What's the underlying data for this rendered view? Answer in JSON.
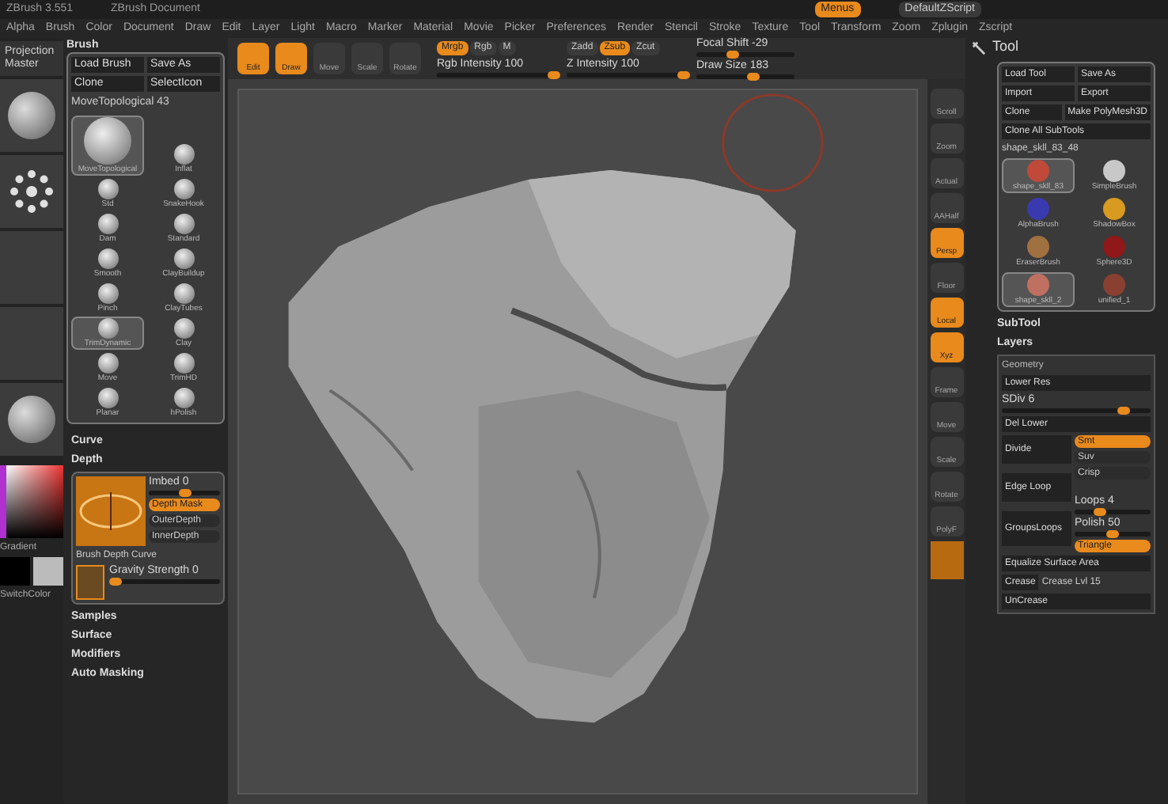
{
  "title_bar": {
    "texts": [
      "ZBrush 3.551",
      "ZBrush Document"
    ],
    "buttons": [
      {
        "label": "Menus",
        "selected": true
      },
      {
        "label": "DefaultZScript",
        "selected": false
      }
    ]
  },
  "menu_bar": [
    "Alpha",
    "Brush",
    "Color",
    "Document",
    "Draw",
    "Edit",
    "Layer",
    "Light",
    "Macro",
    "Marker",
    "Material",
    "Movie",
    "Picker",
    "Preferences",
    "Render",
    "Stencil",
    "Stroke",
    "Texture",
    "Tool",
    "Transform",
    "Zoom",
    "Zplugin",
    "Zscript"
  ],
  "toolbar": {
    "modes": [
      {
        "label": "Edit",
        "selected": true
      },
      {
        "label": "Draw",
        "selected": true
      },
      {
        "label": "Move",
        "selected": false
      },
      {
        "label": "Scale",
        "selected": false
      },
      {
        "label": "Rotate",
        "selected": false
      }
    ],
    "rgb": [
      {
        "label": "Mrgb",
        "selected": true
      },
      {
        "label": "Rgb",
        "selected": false
      },
      {
        "label": "M",
        "selected": false
      }
    ],
    "z": [
      {
        "label": "Zadd",
        "selected": false
      },
      {
        "label": "Zsub",
        "selected": true
      },
      {
        "label": "Zcut",
        "selected": false
      }
    ],
    "sliders": [
      {
        "label": "Rgb Intensity 100",
        "level": 1
      },
      {
        "label": "Z Intensity 100",
        "level": 1
      },
      {
        "label": "Focal Shift -29",
        "level": 0.36
      },
      {
        "label": "Draw Size 183",
        "level": 0.6
      }
    ]
  },
  "left_shelf": {
    "label": "Projection Master",
    "tiles": [
      {
        "kind": "sphere"
      },
      {
        "kind": "dots"
      },
      {
        "kind": "plain"
      },
      {
        "kind": "plain"
      },
      {
        "kind": "sphere"
      }
    ]
  },
  "brush_palette": {
    "title": "Brush",
    "buttons": [
      "Load Brush",
      "Save As",
      "Clone",
      "SelectIcon"
    ],
    "current": "MoveTopological 43",
    "brushes": [
      {
        "label": "MoveTopological",
        "selected": true
      },
      {
        "label": "Inflat",
        "selected": false
      },
      {
        "label": "Std",
        "selected": false
      },
      {
        "label": "SnakeHook",
        "selected": false
      },
      {
        "label": "Dam",
        "selected": false
      },
      {
        "label": "Standard",
        "selected": false
      },
      {
        "label": "Smooth",
        "selected": false
      },
      {
        "label": "ClayBuildup",
        "selected": false
      },
      {
        "label": "Pinch",
        "selected": false
      },
      {
        "label": "ClayTubes",
        "selected": false
      },
      {
        "label": "TrimDynamic",
        "selected": true
      },
      {
        "label": "Clay",
        "selected": false
      },
      {
        "label": "Move",
        "selected": false
      },
      {
        "label": "TrimHD",
        "selected": false
      },
      {
        "label": "Planar",
        "selected": false
      },
      {
        "label": "hPolish",
        "selected": false
      }
    ]
  },
  "color": {
    "gradient": "Gradient",
    "switch": "SwitchColor"
  },
  "brush_sections": [
    "Curve",
    "Depth",
    "Samples",
    "Surface",
    "Modifiers",
    "Auto Masking"
  ],
  "depth": {
    "imbed": {
      "label": "Imbed 0",
      "level": 0.5
    },
    "toggles": [
      {
        "label": "Depth Mask",
        "on": true
      },
      {
        "label": "OuterDepth",
        "on": false
      },
      {
        "label": "InnerDepth",
        "on": false
      }
    ],
    "curve": "Brush Depth Curve",
    "gravity": {
      "label": "Gravity Strength 0",
      "level": 0
    }
  },
  "right_shelf": [
    {
      "label": "Scroll",
      "on": false
    },
    {
      "label": "Zoom",
      "on": false
    },
    {
      "label": "Actual",
      "on": false
    },
    {
      "label": "AAHalf",
      "on": false
    },
    {
      "label": "Persp",
      "on": true
    },
    {
      "label": "Floor",
      "on": false
    },
    {
      "label": "Local",
      "on": true
    },
    {
      "label": "Xyz",
      "on": true
    },
    {
      "label": "Frame",
      "on": false
    },
    {
      "label": "Move",
      "on": false
    },
    {
      "label": "Scale",
      "on": false
    },
    {
      "label": "Rotate",
      "on": false
    },
    {
      "label": "PolyF",
      "on": false
    }
  ],
  "tool": {
    "title": "Tool",
    "buttons": [
      [
        "Load Tool",
        "Save As"
      ],
      [
        "Import",
        "Export"
      ],
      [
        "Clone",
        "Make PolyMesh3D"
      ],
      [
        "Clone All SubTools"
      ]
    ],
    "current": "shape_skll_83_48",
    "tools": [
      {
        "label": "shape_skll_83",
        "selected": true,
        "color": "#c0493a"
      },
      {
        "label": "SimpleBrush",
        "selected": false,
        "color": "#c8c8c8"
      },
      {
        "label": "AlphaBrush",
        "selected": false,
        "color": "#3a3ab0"
      },
      {
        "label": "ShadowBox",
        "selected": false,
        "color": "#d89a20"
      },
      {
        "label": "EraserBrush",
        "selected": false,
        "color": "#a07040"
      },
      {
        "label": "Sphere3D",
        "selected": false,
        "color": "#901818"
      },
      {
        "label": "shape_skll_2",
        "selected": true,
        "color": "#c07060"
      },
      {
        "label": "unified_1",
        "selected": false,
        "color": "#8a4030"
      }
    ],
    "sections": [
      "SubTool",
      "Layers"
    ],
    "geometry": {
      "title": "Geometry",
      "lower_res": "Lower Res",
      "sdiv": {
        "label": "SDiv 6",
        "level": 0.85
      },
      "del_lower": "Del Lower",
      "divide": "Divide",
      "divide_opts": [
        {
          "label": "Smt",
          "on": true
        },
        {
          "label": "Suv",
          "on": false
        },
        {
          "label": "Crisp",
          "on": false
        }
      ],
      "edge_loop": "Edge Loop",
      "groups_loops": "GroupsLoops",
      "loops": [
        {
          "label": "Loops 4",
          "level": 0.3
        },
        {
          "label": "Polish 50",
          "level": 0.5
        }
      ],
      "triangle": {
        "label": "Triangle",
        "on": true
      },
      "equalize": "Equalize Surface Area",
      "crease": "Crease",
      "crease_lvl": "Crease Lvl 15",
      "uncrease": "UnCrease"
    }
  }
}
